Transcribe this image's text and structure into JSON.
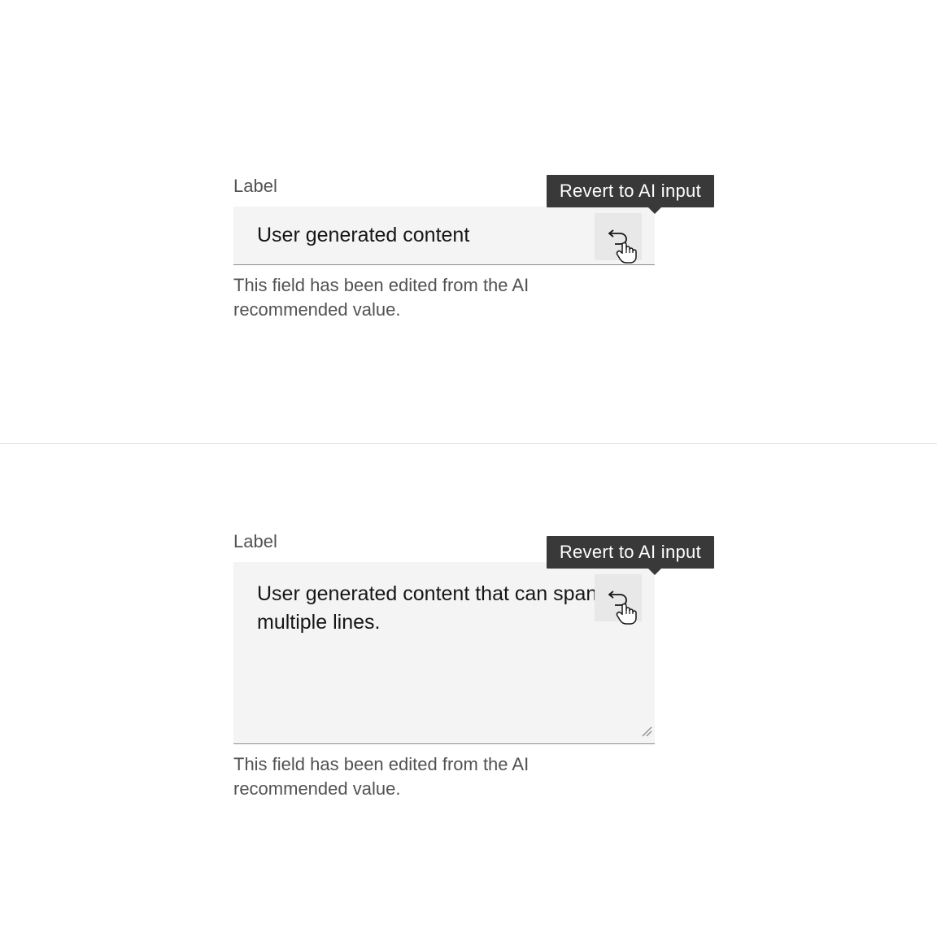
{
  "field1": {
    "label": "Label",
    "value": "User generated content",
    "helper": "This field has been edited from the AI recommended value.",
    "tooltip": "Revert to AI input"
  },
  "field2": {
    "label": "Label",
    "value": "User generated content that can span multiple lines.",
    "helper": "This field has been edited from the AI recommended value.",
    "tooltip": "Revert to AI input"
  }
}
